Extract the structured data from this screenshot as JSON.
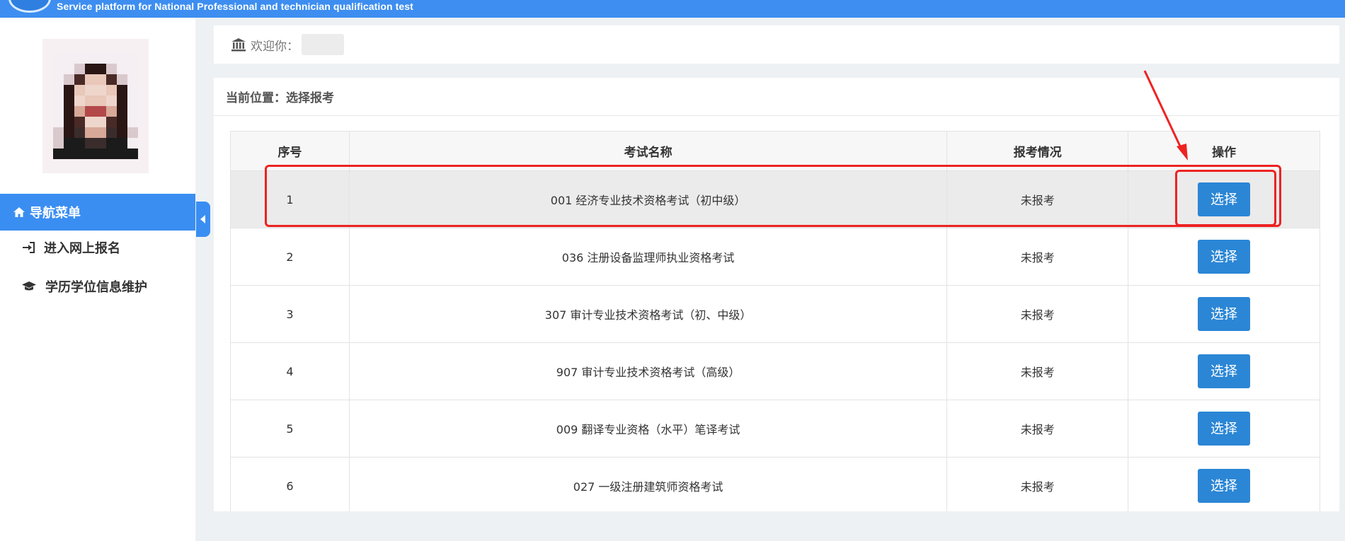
{
  "header": {
    "subtitle": "Service platform for National Professional and technician qualification test"
  },
  "sidebar": {
    "nav_title": "导航菜单",
    "items": [
      {
        "label": "进入网上报名",
        "icon": "sign-in-icon"
      },
      {
        "label": "学历学位信息维护",
        "icon": "graduation-cap-icon"
      }
    ]
  },
  "welcome": {
    "label": "欢迎你："
  },
  "main": {
    "breadcrumb": "当前位置：选择报考",
    "columns": [
      "序号",
      "考试名称",
      "报考情况",
      "操作"
    ],
    "rows": [
      {
        "idx": "1",
        "name": "001 经济专业技术资格考试（初中级）",
        "status": "未报考",
        "action": "选择"
      },
      {
        "idx": "2",
        "name": "036 注册设备监理师执业资格考试",
        "status": "未报考",
        "action": "选择"
      },
      {
        "idx": "3",
        "name": "307 审计专业技术资格考试（初、中级）",
        "status": "未报考",
        "action": "选择"
      },
      {
        "idx": "4",
        "name": "907 审计专业技术资格考试（高级）",
        "status": "未报考",
        "action": "选择"
      },
      {
        "idx": "5",
        "name": "009 翻译专业资格（水平）笔译考试",
        "status": "未报考",
        "action": "选择"
      },
      {
        "idx": "6",
        "name": "027 一级注册建筑师资格考试",
        "status": "未报考",
        "action": "选择"
      }
    ]
  },
  "colors": {
    "header_blue": "#3d8ef0",
    "nav_active": "#3a8ef2",
    "button_blue": "#2b86d5",
    "annotation_red": "#ee2222"
  }
}
